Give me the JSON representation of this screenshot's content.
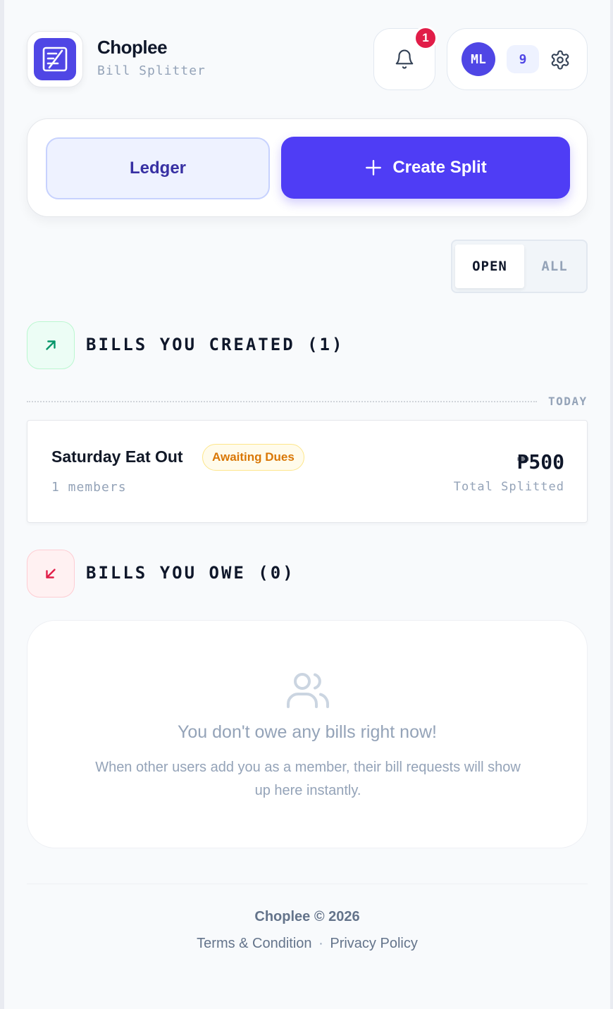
{
  "brand": {
    "name": "Choplee",
    "subtitle": "Bill Splitter",
    "accent_color": "#4f46e5"
  },
  "header": {
    "notification_icon": "bell-icon",
    "notification_count": "1",
    "user_initials": "ML",
    "user_count": "9",
    "settings_icon": "gear-icon"
  },
  "actions": {
    "ledger_label": "Ledger",
    "create_label": "Create Split",
    "create_icon": "plus-icon"
  },
  "filter": {
    "open_label": "OPEN",
    "all_label": "ALL",
    "selected": "OPEN"
  },
  "created_section": {
    "title": "BILLS YOU CREATED (1)",
    "icon": "arrow-up-right-icon",
    "group_label": "TODAY",
    "bills": [
      {
        "name": "Saturday Eat Out",
        "status": "Awaiting Dues",
        "members": "1 members",
        "amount": "₱500",
        "amount_label": "Total Splitted"
      }
    ]
  },
  "owe_section": {
    "title": "BILLS YOU OWE (0)",
    "icon": "arrow-down-left-icon",
    "empty_icon": "users-icon",
    "empty_title": "You don't owe any bills right now!",
    "empty_description": "When other users add you as a member, their bill requests will show up here instantly."
  },
  "footer": {
    "copyright": "Choplee © 2026",
    "terms_label": "Terms & Condition",
    "separator": "·",
    "privacy_label": "Privacy Policy"
  }
}
